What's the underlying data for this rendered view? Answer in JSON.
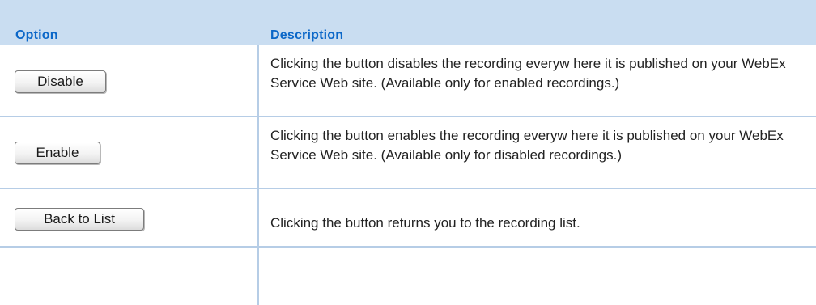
{
  "table": {
    "headers": {
      "option": "Option",
      "description": "Description"
    },
    "rows": [
      {
        "button_label": "Disable",
        "description": "Clicking the button disables the recording everyw here it is published on your WebEx Service Web site. (Available only for enabled recordings.)"
      },
      {
        "button_label": "Enable",
        "description": "Clicking the button enables the recording everyw here it is published on your WebEx Service Web site. (Available only for disabled recordings.)"
      },
      {
        "button_label": "Back to List",
        "description": "Clicking the button returns you to the recording list."
      }
    ]
  },
  "colors": {
    "header_background": "#c9ddf1",
    "header_text": "#0b67c8",
    "grid_lines": "#b6cde6"
  }
}
